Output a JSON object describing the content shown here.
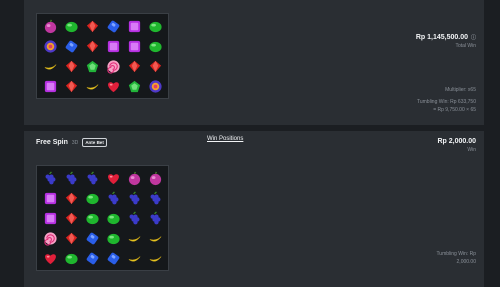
{
  "round1": {
    "grid": [
      [
        "plum",
        "green-gem",
        "red-gem",
        "blue-candy",
        "purple-cube",
        "green-gem"
      ],
      [
        "scatter-lollipop",
        "blue-candy",
        "red-gem",
        "purple-cube",
        "purple-cube",
        "green-gem"
      ],
      [
        "banana",
        "red-gem",
        "green-pentagon",
        "swirl-lollipop",
        "red-gem",
        "red-gem"
      ],
      [
        "purple-cube",
        "red-gem",
        "banana",
        "heart",
        "green-pentagon",
        "scatter-lollipop"
      ]
    ],
    "amount": "Rp 1,145,500.00",
    "amount_label": "Total Win",
    "info_icon": "ⓘ",
    "multiplier": "Multiplier: x65",
    "tumbling_line1": "Tumbling Win: Rp 633,750",
    "tumbling_line2": "= Rp 9,750.00 × 65"
  },
  "round2": {
    "title": "Free Spin",
    "count": "3D",
    "badge": "Ante Bet",
    "amount": "Rp 2,000.00",
    "amount_label": "Win",
    "tumbling_line1": "Tumbling Win: Rp",
    "tumbling_line2": "2,000.00",
    "grid": [
      [
        "grape",
        "grape",
        "grape",
        "heart",
        "plum",
        "plum"
      ],
      [
        "purple-cube",
        "red-gem",
        "green-gem",
        "grape",
        "grape",
        "grape"
      ],
      [
        "purple-cube",
        "red-gem",
        "green-gem",
        "green-gem",
        "grape",
        "grape"
      ],
      [
        "swirl-lollipop",
        "red-gem",
        "blue-candy",
        "green-gem",
        "banana",
        "banana"
      ],
      [
        "heart",
        "green-gem",
        "blue-candy",
        "blue-candy",
        "banana",
        "banana"
      ]
    ],
    "win_positions_link": "Win Positions"
  }
}
